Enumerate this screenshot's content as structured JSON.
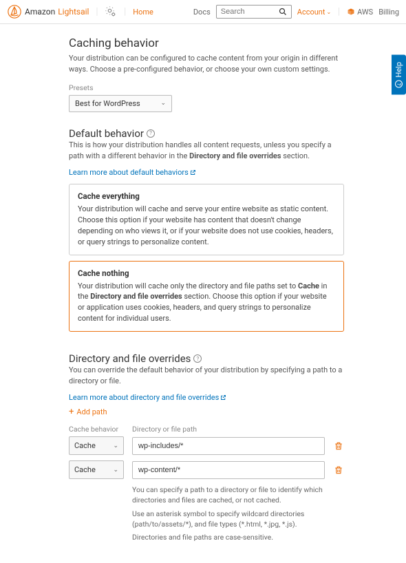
{
  "nav": {
    "brand_first": "Amazon",
    "brand_second": "Lightsail",
    "home": "Home",
    "docs": "Docs",
    "search_placeholder": "Search",
    "account": "Account",
    "aws": "AWS",
    "billing": "Billing"
  },
  "help_tab": "Help",
  "caching": {
    "title": "Caching behavior",
    "desc": "Your distribution can be configured to cache content from your origin in different ways. Choose a pre-configured behavior, or choose your own custom settings.",
    "presets_label": "Presets",
    "preset_selected": "Best for WordPress"
  },
  "default_behavior": {
    "title": "Default behavior",
    "desc_pre": "This is how your distribution handles all content requests, unless you specify a path with a different behavior in the ",
    "desc_bold": "Directory and file overrides",
    "desc_post": " section.",
    "learn_more": "Learn more about default behaviors",
    "options": [
      {
        "title": "Cache everything",
        "desc": "Your distribution will cache and serve your entire website as static content. Choose this option if your website has content that doesn't change depending on who views it, or if your website does not use cookies, headers, or query strings to personalize content."
      },
      {
        "title": "Cache nothing",
        "desc_pre": "Your distribution will cache only the directory and file paths set to ",
        "desc_b1": "Cache",
        "desc_mid": " in the ",
        "desc_b2": "Directory and file overrides",
        "desc_post": " section. Choose this option if your website or application uses cookies, headers, and query strings to personalize content for individual users."
      }
    ]
  },
  "overrides": {
    "title": "Directory and file overrides",
    "desc": "You can override the default behavior of your distribution by specifying a path to a directory or file.",
    "learn_more": "Learn more about directory and file overrides",
    "add_path": "Add path",
    "col_behavior": "Cache behavior",
    "col_path": "Directory or file path",
    "rows": [
      {
        "behavior": "Cache",
        "path": "wp-includes/*"
      },
      {
        "behavior": "Cache",
        "path": "wp-content/*"
      }
    ],
    "hints": [
      "You can specify a path to a directory or file to identify which directories and files are cached, or not cached.",
      "Use an asterisk symbol to specify wildcard directories (path/to/assets/*), and file types (*.html, *.jpg, *.js).",
      "Directories and file paths are case-sensitive."
    ]
  }
}
